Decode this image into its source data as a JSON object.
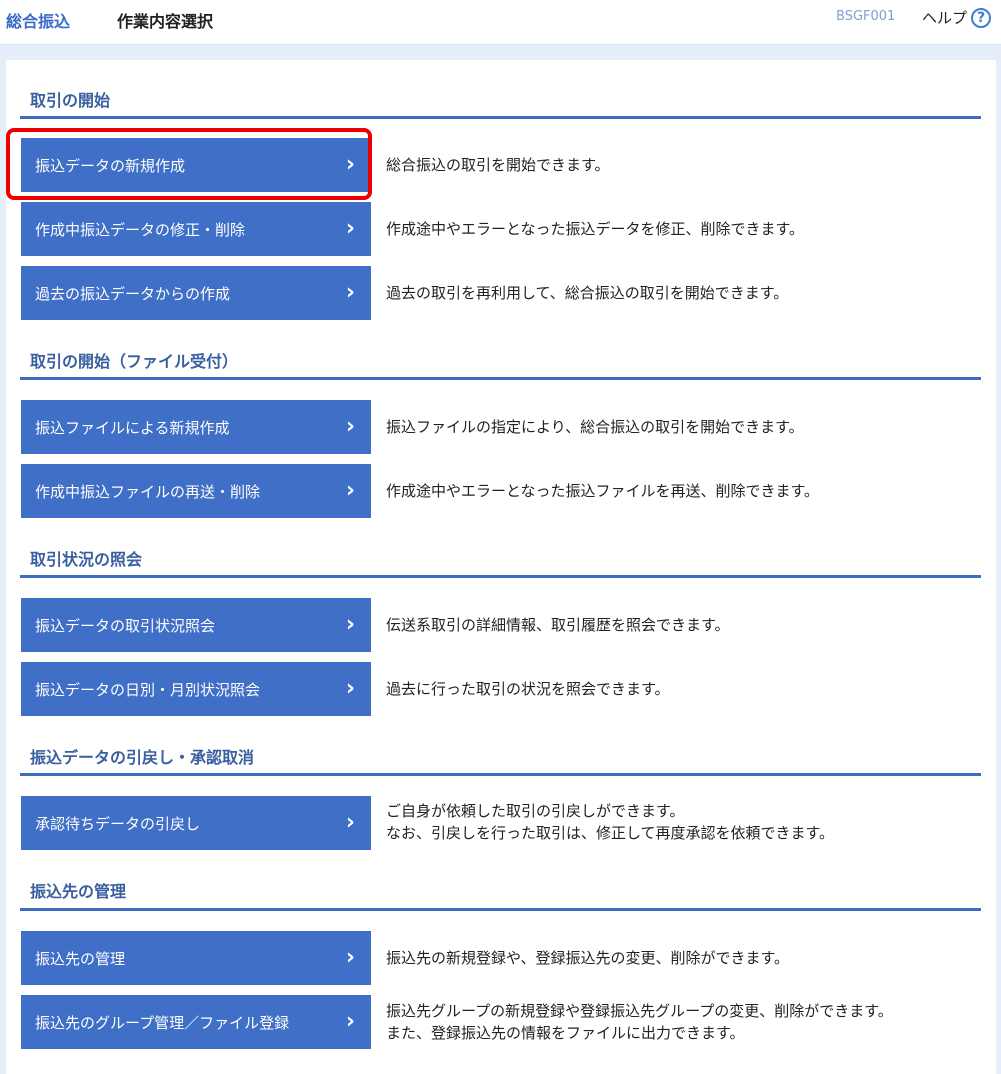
{
  "header": {
    "app_title": "総合振込",
    "page_title": "作業内容選択",
    "screen_id": "BSGF001",
    "help_label": "ヘルプ",
    "help_icon": "?"
  },
  "sections": [
    {
      "title": "取引の開始",
      "items": [
        {
          "label": "振込データの新規作成",
          "desc1": "総合振込の取引を開始できます。",
          "desc2": ""
        },
        {
          "label": "作成中振込データの修正・削除",
          "desc1": "作成途中やエラーとなった振込データを修正、削除できます。",
          "desc2": ""
        },
        {
          "label": "過去の振込データからの作成",
          "desc1": "過去の取引を再利用して、総合振込の取引を開始できます。",
          "desc2": ""
        }
      ]
    },
    {
      "title": "取引の開始（ファイル受付）",
      "items": [
        {
          "label": "振込ファイルによる新規作成",
          "desc1": "振込ファイルの指定により、総合振込の取引を開始できます。",
          "desc2": ""
        },
        {
          "label": "作成中振込ファイルの再送・削除",
          "desc1": "作成途中やエラーとなった振込ファイルを再送、削除できます。",
          "desc2": ""
        }
      ]
    },
    {
      "title": "取引状況の照会",
      "items": [
        {
          "label": "振込データの取引状況照会",
          "desc1": "伝送系取引の詳細情報、取引履歴を照会できます。",
          "desc2": ""
        },
        {
          "label": "振込データの日別・月別状況照会",
          "desc1": "過去に行った取引の状況を照会できます。",
          "desc2": ""
        }
      ]
    },
    {
      "title": "振込データの引戻し・承認取消",
      "items": [
        {
          "label": "承認待ちデータの引戻し",
          "desc1": "ご自身が依頼した取引の引戻しができます。",
          "desc2": "なお、引戻しを行った取引は、修正して再度承認を依頼できます。"
        }
      ]
    },
    {
      "title": "振込先の管理",
      "items": [
        {
          "label": "振込先の管理",
          "desc1": "振込先の新規登録や、登録振込先の変更、削除ができます。",
          "desc2": ""
        },
        {
          "label": "振込先のグループ管理／ファイル登録",
          "desc1": "振込先グループの新規登録や登録振込先グループの変更、削除ができます。",
          "desc2": "また、登録振込先の情報をファイルに出力できます。"
        }
      ]
    }
  ],
  "icons": {
    "chevron": "›"
  },
  "colors": {
    "button_bg": "#3f6fc6",
    "section_line": "#3d6cc0",
    "highlight": "#ee0000",
    "page_bg": "#e6eef9"
  }
}
